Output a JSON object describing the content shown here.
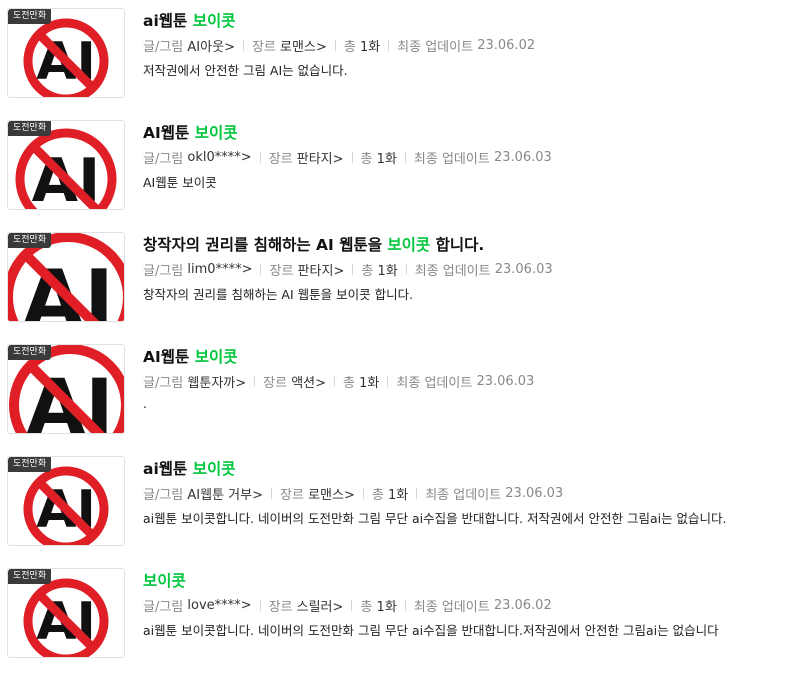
{
  "labels": {
    "badge": "도전만화",
    "author": "글/그림",
    "genre": "장르",
    "total": "총",
    "updated": "최종 업데이트",
    "arrow": ">"
  },
  "colors": {
    "highlight": "#00c73c",
    "sign_red": "#e01e26",
    "badge_bg": "#3a3a3a"
  },
  "items": [
    {
      "title_pre": "ai웹툰 ",
      "title_hl": "보이콧",
      "title_post": "",
      "author": "AI아웃",
      "genre": "로맨스",
      "episodes": "1화",
      "date": "23.06.02",
      "desc": "저작권에서 안전한 그림 AI는 없습니다.",
      "thumb": "no-ai-sign-icon"
    },
    {
      "title_pre": "AI웹툰 ",
      "title_hl": "보이콧",
      "title_post": "",
      "author": "okl0****",
      "genre": "판타지",
      "episodes": "1화",
      "date": "23.06.03",
      "desc": "AI웹툰 보이콧",
      "thumb": "no-ai-sign-icon"
    },
    {
      "title_pre": "창작자의 권리를 침해하는 AI 웹툰을 ",
      "title_hl": "보이콧",
      "title_post": " 합니다.",
      "author": "lim0****",
      "genre": "판타지",
      "episodes": "1화",
      "date": "23.06.03",
      "desc": "창작자의 권리를 침해하는 AI 웹툰을 보이콧 합니다.",
      "thumb": "no-ai-sign-icon"
    },
    {
      "title_pre": "AI웹툰 ",
      "title_hl": "보이콧",
      "title_post": "",
      "author": "웹툰자까",
      "genre": "액션",
      "episodes": "1화",
      "date": "23.06.03",
      "desc": ".",
      "thumb": "no-ai-sign-icon"
    },
    {
      "title_pre": "ai웹툰 ",
      "title_hl": "보이콧",
      "title_post": "",
      "author": "AI웹툰 거부",
      "genre": "로맨스",
      "episodes": "1화",
      "date": "23.06.03",
      "desc": "ai웹툰 보이콧합니다. 네이버의 도전만화 그림 무단 ai수집을 반대합니다. 저작권에서 안전한 그림ai는 없습니다.",
      "thumb": "no-ai-sign-icon"
    },
    {
      "title_pre": "",
      "title_hl": "보이콧",
      "title_post": "",
      "author": "love****",
      "genre": "스릴러",
      "episodes": "1화",
      "date": "23.06.02",
      "desc": "ai웹툰 보이콧합니다. 네이버의 도전만화 그림 무단 ai수집을 반대합니다.저작권에서 안전한 그림ai는 없습니다",
      "thumb": "no-ai-sign-icon"
    }
  ]
}
